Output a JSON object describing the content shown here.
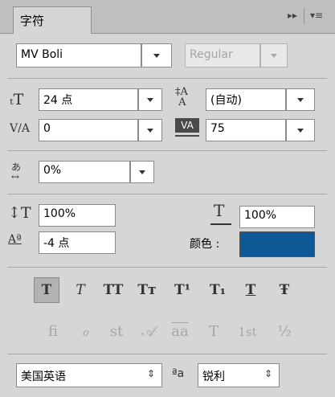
{
  "panel": {
    "tab_title": "字符",
    "collapse_glyph": "▸▸",
    "menu_glyph": "▾≡"
  },
  "font": {
    "family": "MV Boli",
    "style": "Regular"
  },
  "size": {
    "value": "24 点",
    "icon": "font-size-icon"
  },
  "leading": {
    "value": "(自动)",
    "icon": "leading-icon"
  },
  "kerning": {
    "value": "0",
    "icon": "kerning-icon"
  },
  "tracking": {
    "value": "75",
    "icon": "tracking-icon"
  },
  "tsume": {
    "value": "0%",
    "icon": "tsume-icon"
  },
  "vertical_scale": {
    "value": "100%",
    "icon": "vertical-scale-icon"
  },
  "horizontal_scale": {
    "value": "100%",
    "icon": "horizontal-scale-icon"
  },
  "baseline_shift": {
    "value": "-4 点",
    "icon": "baseline-shift-icon"
  },
  "color": {
    "label": "颜色 :",
    "swatch": "#0d5895"
  },
  "style_buttons": [
    {
      "glyph": "T"
    },
    {
      "glyph": "T"
    },
    {
      "glyph": "TT"
    },
    {
      "glyph": "Tт"
    },
    {
      "glyph": "T¹"
    },
    {
      "glyph": "T₁"
    },
    {
      "glyph": "T"
    },
    {
      "glyph": "Ŧ"
    }
  ],
  "opentype_buttons": [
    {
      "glyph": "ﬁ"
    },
    {
      "glyph": "ℴ"
    },
    {
      "glyph": "st"
    },
    {
      "glyph": "𝒜"
    },
    {
      "glyph": "aa"
    },
    {
      "glyph": "T"
    },
    {
      "glyph": "1st"
    },
    {
      "glyph": "½"
    }
  ],
  "language": {
    "value": "美国英语"
  },
  "antialias": {
    "icon_text": "ªa",
    "value": "锐利"
  }
}
